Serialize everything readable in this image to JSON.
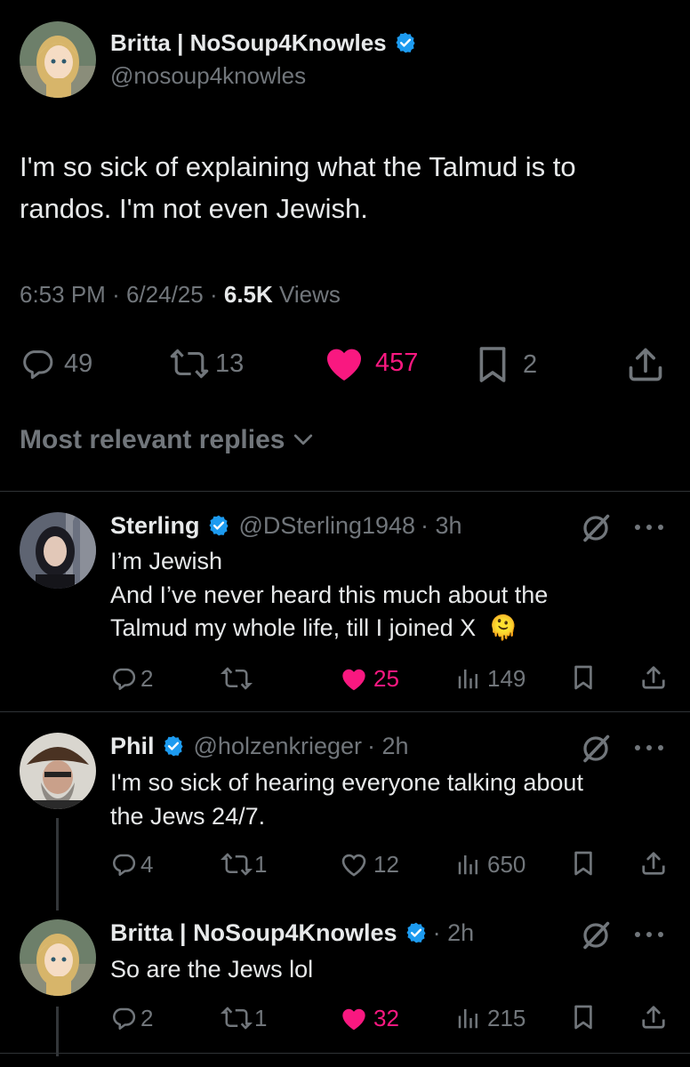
{
  "main_tweet": {
    "author_name": "Britta | NoSoup4Knowles",
    "handle": "@nosoup4knowles",
    "text_line1": "I'm so sick of explaining what the Talmud is to",
    "text_line2": "randos. I'm not even Jewish.",
    "time": "6:53 PM",
    "date": "6/24/25",
    "dot": "·",
    "views_count": "6.5K",
    "views_label": "Views",
    "replies": "49",
    "reposts": "13",
    "likes": "457",
    "bookmarks": "2"
  },
  "replies_header": {
    "label": "Most relevant replies"
  },
  "replies": [
    {
      "name": "Sterling",
      "handle": "@DSterling1948",
      "age": "· 3h",
      "line1": "I’m Jewish",
      "line2": "And I’ve never heard this much about the",
      "line3": "Talmud my whole life, till I joined X",
      "emoji": "🫠",
      "replies": "2",
      "reposts": "",
      "likes": "25",
      "views": "149"
    },
    {
      "name": "Phil",
      "handle": "@holzenkrieger",
      "age": "· 2h",
      "line1": "I'm so sick of hearing everyone talking about",
      "line2": "the Jews 24/7.",
      "replies": "4",
      "reposts": "1",
      "likes": "12",
      "views": "650"
    },
    {
      "name": "Britta | NoSoup4Knowles",
      "handle": "",
      "age": "· 2h",
      "line1": "So are the Jews lol",
      "replies": "2",
      "reposts": "1",
      "likes": "32",
      "views": "215"
    }
  ],
  "colors": {
    "background": "#000000",
    "text": "#e7e9ea",
    "muted": "#71767b",
    "like": "#f91880",
    "verified": "#1d9bf0",
    "divider": "#2f3336"
  },
  "icons": [
    "reply-icon",
    "repost-icon",
    "heart-icon",
    "bookmark-icon",
    "share-icon",
    "views-icon",
    "verified-badge-icon",
    "grok-icon",
    "more-icon",
    "chevron-down-icon"
  ]
}
